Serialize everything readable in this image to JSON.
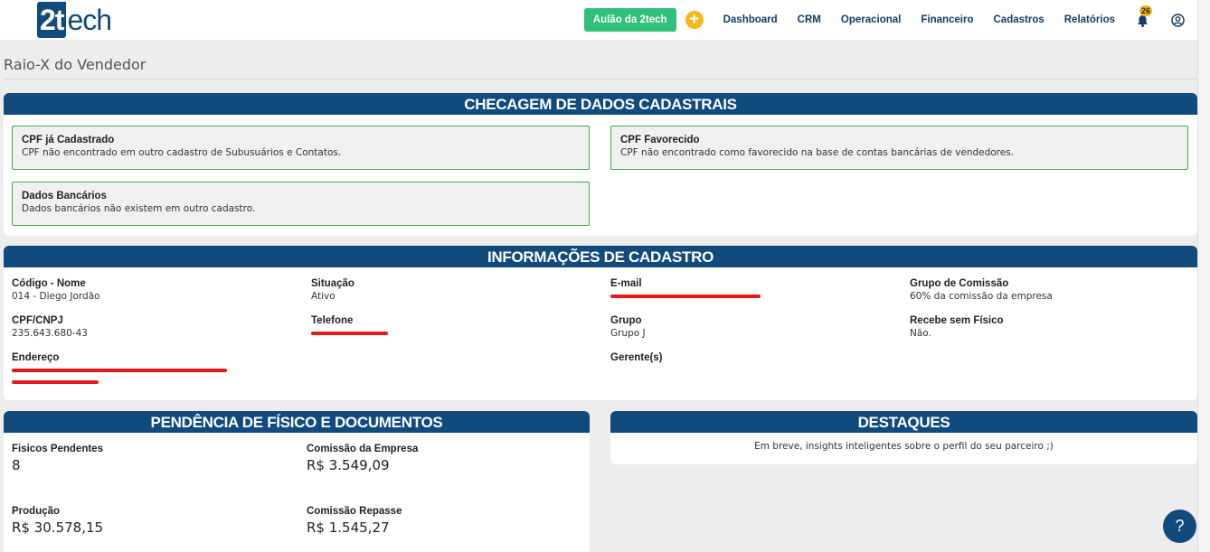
{
  "brand": {
    "logo_box": "2t",
    "logo_rest": "ech"
  },
  "nav": {
    "aulao": "Aulão da 2tech",
    "items": [
      "Dashboard",
      "CRM",
      "Operacional",
      "Financeiro",
      "Cadastros",
      "Relatórios"
    ],
    "notification_count": "26"
  },
  "page": {
    "title": "Raio-X do Vendedor"
  },
  "checagem": {
    "header": "CHECAGEM DE DADOS CADASTRAIS",
    "cpf_cadastrado": {
      "title": "CPF já Cadastrado",
      "desc": "CPF não encontrado em outro cadastro de Subusuários e Contatos."
    },
    "cpf_favorecido": {
      "title": "CPF Favorecido",
      "desc": "CPF não encontrado como favorecido na base de contas bancárias de vendedores."
    },
    "dados_bancarios": {
      "title": "Dados Bancários",
      "desc": "Dados bancários não existem em outro cadastro."
    }
  },
  "cadastro": {
    "header": "INFORMAÇÕES DE CADASTRO",
    "codigo_nome": {
      "label": "Código - Nome",
      "value": "014 - Diego Jordão"
    },
    "situacao": {
      "label": "Situação",
      "value": "Ativo"
    },
    "email": {
      "label": "E-mail"
    },
    "grupo_comissao": {
      "label": "Grupo de Comissão",
      "value": "60% da comissão da empresa"
    },
    "cpf_cnpj": {
      "label": "CPF/CNPJ",
      "value": "235.643.680-43"
    },
    "telefone": {
      "label": "Telefone"
    },
    "grupo": {
      "label": "Grupo",
      "value": "Grupo J"
    },
    "recebe_sem_fisico": {
      "label": "Recebe sem Físico",
      "value": "Não."
    },
    "endereco": {
      "label": "Endereço"
    },
    "gerentes": {
      "label": "Gerente(s)"
    }
  },
  "pendencia": {
    "header": "PENDÊNCIA DE FÍSICO E DOCUMENTOS",
    "fisicos_pendentes": {
      "label": "Fisicos Pendentes",
      "value": "8"
    },
    "comissao_empresa": {
      "label": "Comissão da Empresa",
      "value": "R$ 3.549,09"
    },
    "producao": {
      "label": "Produção",
      "value": "R$ 30.578,15"
    },
    "comissao_repasse": {
      "label": "Comissão Repasse",
      "value": "R$ 1.545,27"
    }
  },
  "destaques": {
    "header": "DESTAQUES",
    "text": "Em breve, insights inteligentes sobre o perfil do seu parceiro ;)"
  },
  "help": {
    "label": "?"
  },
  "colors": {
    "primary": "#114a7d",
    "success": "#2fc07a",
    "accent": "#f3b817",
    "redaction": "#e41a1a"
  }
}
